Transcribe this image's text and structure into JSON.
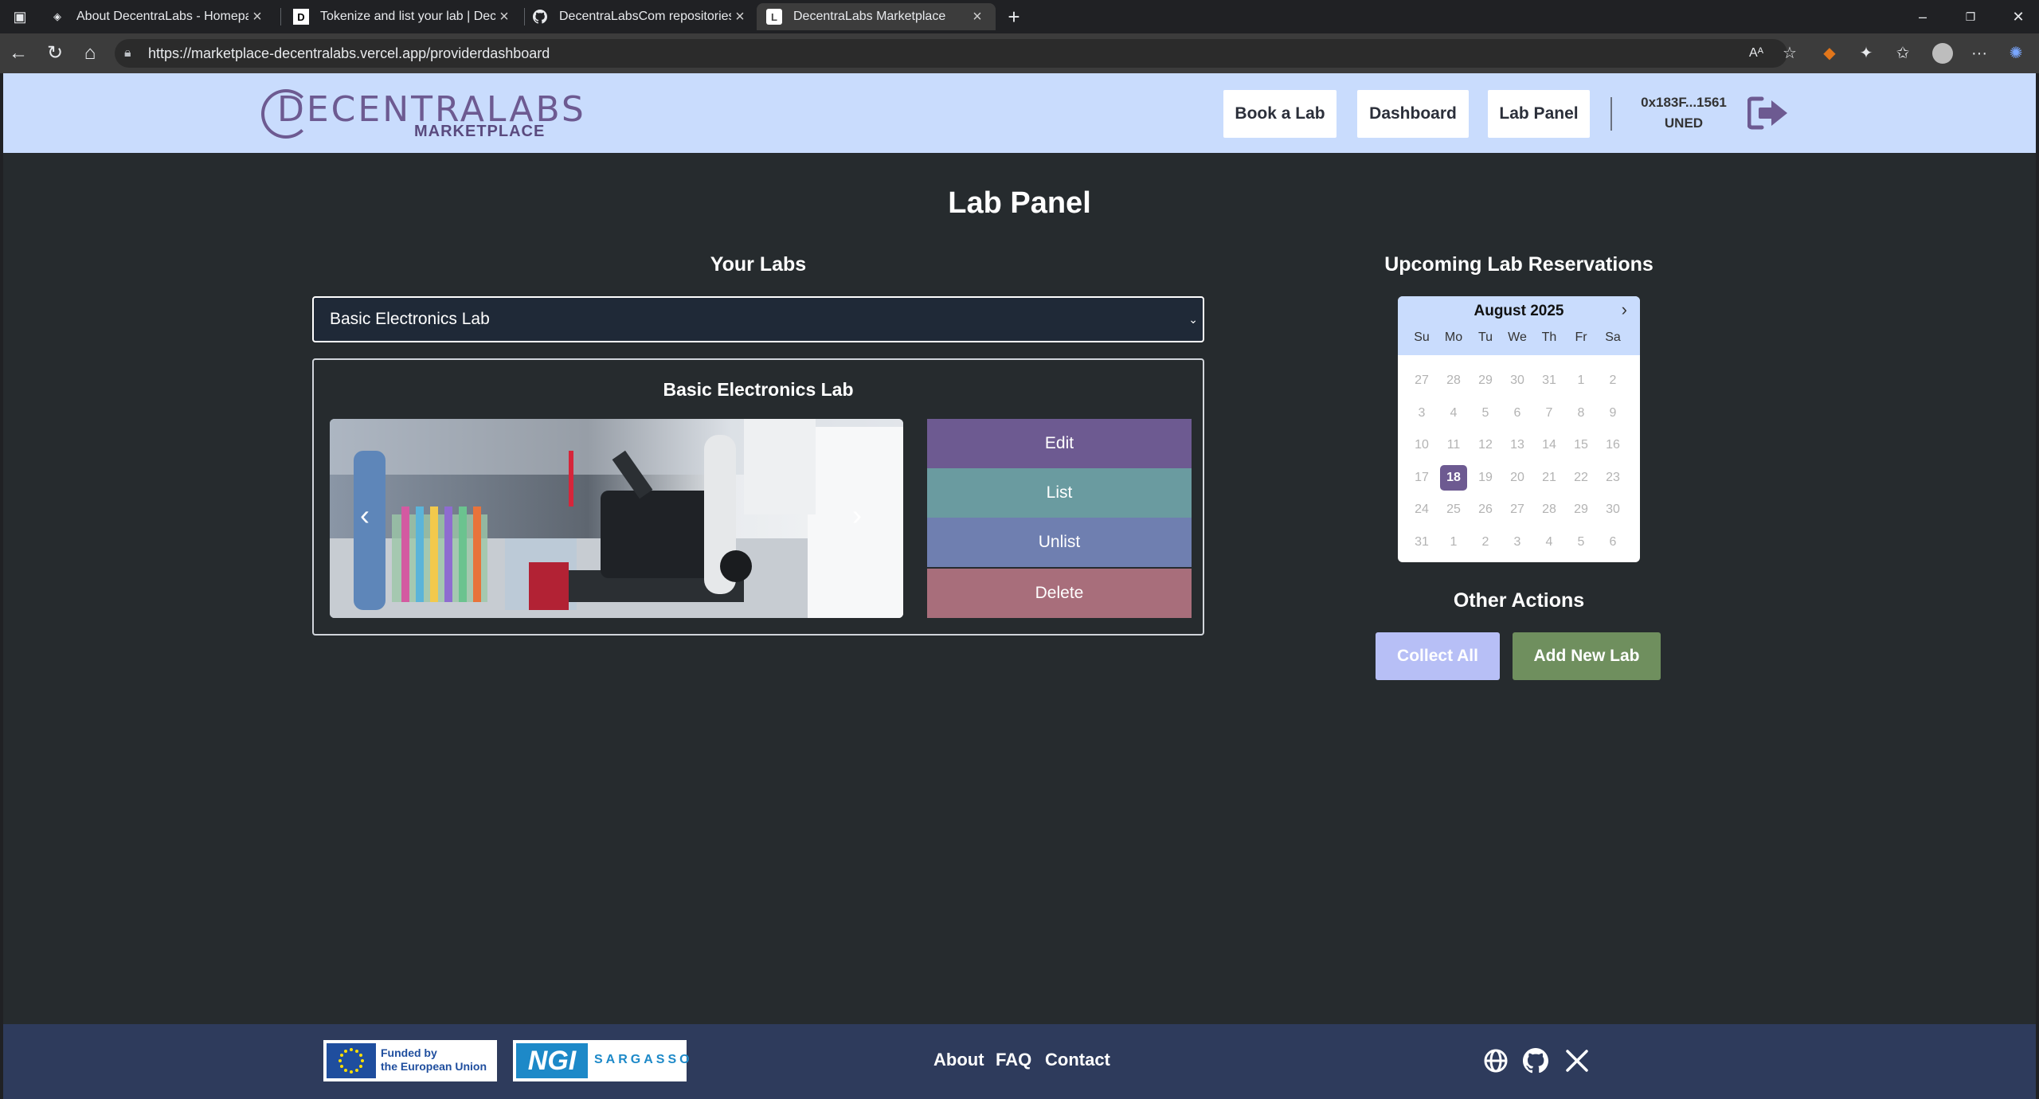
{
  "browser": {
    "tabs": [
      {
        "title": "About DecentraLabs - Homepage",
        "icon": "layers-icon"
      },
      {
        "title": "Tokenize and list your lab | Decentra",
        "icon": "d-icon"
      },
      {
        "title": "DecentraLabsCom repositories",
        "icon": "github-icon"
      },
      {
        "title": "DecentraLabs Marketplace",
        "icon": "marketplace-icon",
        "active": true
      }
    ],
    "url": "https://marketplace-decentralabs.vercel.app/providerdashboard"
  },
  "header": {
    "logo_name": "DECENTRALABS",
    "logo_sub": "MARKETPLACE",
    "nav": {
      "book": "Book a Lab",
      "dashboard": "Dashboard",
      "lab_panel": "Lab Panel"
    },
    "wallet_address": "0x183F...1561",
    "wallet_org": "UNED"
  },
  "main": {
    "title": "Lab Panel",
    "your_labs_heading": "Your Labs",
    "selected_lab": "Basic Electronics Lab",
    "lab_card": {
      "title": "Basic Electronics Lab",
      "actions": {
        "edit": "Edit",
        "list": "List",
        "unlist": "Unlist",
        "delete": "Delete"
      }
    },
    "reservations_heading": "Upcoming Lab Reservations",
    "calendar": {
      "month": "August 2025",
      "weekdays": [
        "Su",
        "Mo",
        "Tu",
        "We",
        "Th",
        "Fr",
        "Sa"
      ],
      "weeks": [
        [
          "27",
          "28",
          "29",
          "30",
          "31",
          "1",
          "2"
        ],
        [
          "3",
          "4",
          "5",
          "6",
          "7",
          "8",
          "9"
        ],
        [
          "10",
          "11",
          "12",
          "13",
          "14",
          "15",
          "16"
        ],
        [
          "17",
          "18",
          "19",
          "20",
          "21",
          "22",
          "23"
        ],
        [
          "24",
          "25",
          "26",
          "27",
          "28",
          "29",
          "30"
        ],
        [
          "31",
          "1",
          "2",
          "3",
          "4",
          "5",
          "6"
        ]
      ],
      "selected_day": "18"
    },
    "other_actions_heading": "Other Actions",
    "collect_all": "Collect All",
    "add_new_lab": "Add New Lab"
  },
  "footer": {
    "eu_line1": "Funded by",
    "eu_line2": "the European Union",
    "ngi": "NGI",
    "ngi_sub": "SARGASSO",
    "links": {
      "about": "About",
      "faq": "FAQ",
      "contact": "Contact"
    }
  },
  "colors": {
    "header_bg": "#c9dcfd",
    "page_bg": "#262b2e",
    "edit": "#6d5a91",
    "list": "#6a9ba0",
    "unlist": "#6f7fb0",
    "delete": "#a86e7b",
    "collect_all": "#b7bff6",
    "add_new_lab": "#6f8f5e",
    "footer_bg": "#2e3b5c"
  }
}
